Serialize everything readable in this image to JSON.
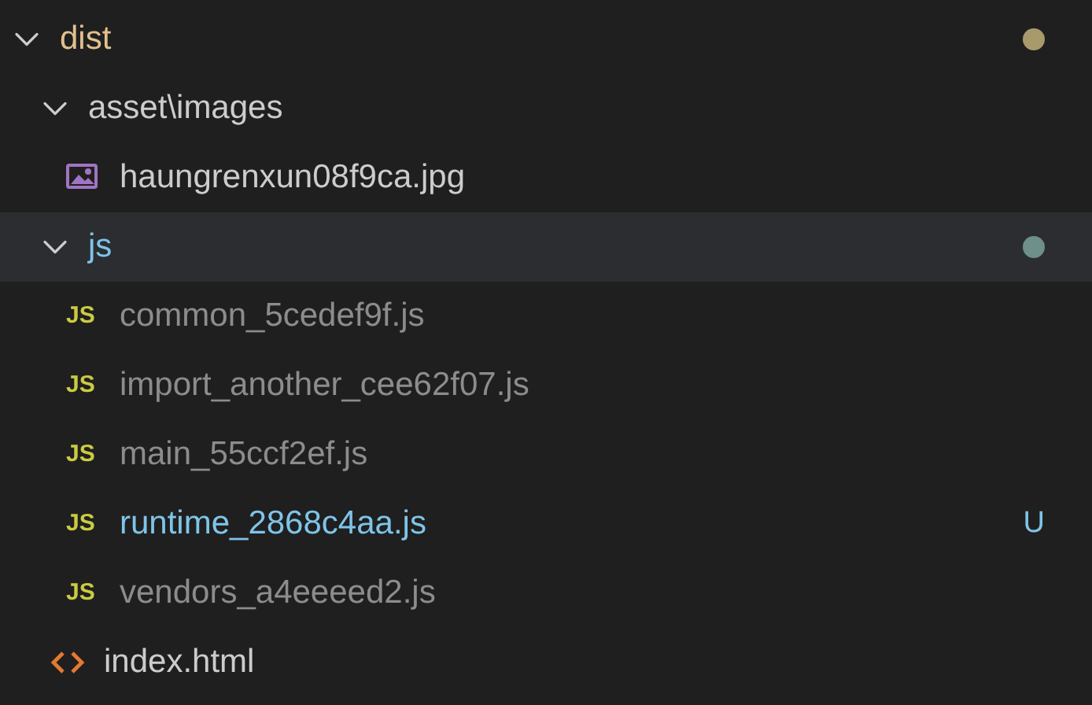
{
  "tree": [
    {
      "label": "dist",
      "kind": "folder",
      "expanded": true,
      "selected": false,
      "modified": true,
      "children": [
        {
          "label": "asset\\images",
          "kind": "folder",
          "expanded": true,
          "selected": false,
          "children": [
            {
              "label": "haungrenxun08f9ca.jpg",
              "kind": "image",
              "selected": false
            }
          ]
        },
        {
          "label": "js",
          "kind": "folder",
          "expanded": true,
          "selected": true,
          "untracked": true,
          "children": [
            {
              "label": "common_5cedef9f.js",
              "kind": "js",
              "icon_text": "JS",
              "selected": false,
              "ignored": true
            },
            {
              "label": "import_another_cee62f07.js",
              "kind": "js",
              "icon_text": "JS",
              "selected": false,
              "ignored": true
            },
            {
              "label": "main_55ccf2ef.js",
              "kind": "js",
              "icon_text": "JS",
              "selected": false,
              "ignored": true
            },
            {
              "label": "runtime_2868c4aa.js",
              "kind": "js",
              "icon_text": "JS",
              "selected": false,
              "untracked": true,
              "badge": "U"
            },
            {
              "label": "vendors_a4eeeed2.js",
              "kind": "js",
              "icon_text": "JS",
              "selected": false,
              "ignored": true
            }
          ]
        },
        {
          "label": "index.html",
          "kind": "html",
          "selected": false
        }
      ]
    }
  ]
}
